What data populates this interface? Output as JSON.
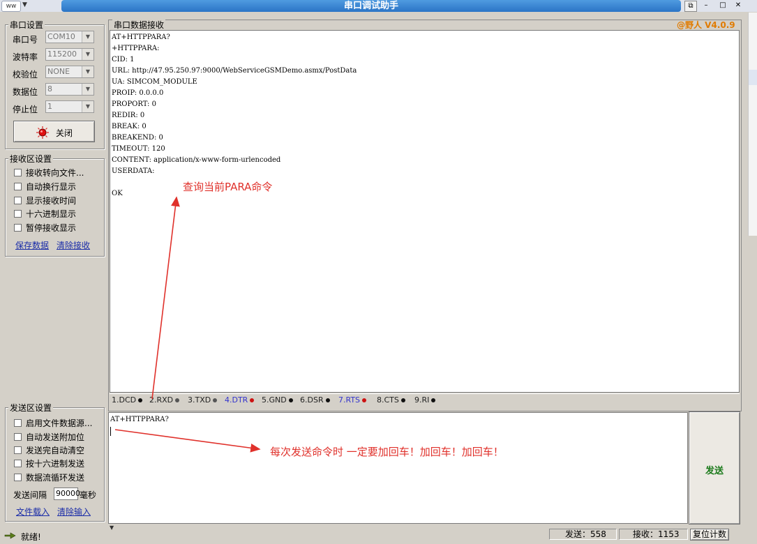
{
  "window": {
    "title": "串口调试助手",
    "sys_icon_text": "ww"
  },
  "serial_settings": {
    "group_title": "串口设置",
    "port_label": "串口号",
    "port_value": "COM10",
    "baud_label": "波特率",
    "baud_value": "115200",
    "parity_label": "校验位",
    "parity_value": "NONE",
    "databits_label": "数据位",
    "databits_value": "8",
    "stopbits_label": "停止位",
    "stopbits_value": "1",
    "close_button": "关闭"
  },
  "receive_settings": {
    "group_title": "接收区设置",
    "options": [
      "接收转向文件...",
      "自动换行显示",
      "显示接收时间",
      "十六进制显示",
      "暂停接收显示"
    ],
    "save_link": "保存数据",
    "clear_link": "清除接收"
  },
  "send_settings": {
    "group_title": "发送区设置",
    "options": [
      "启用文件数据源...",
      "自动发送附加位",
      "发送完自动清空",
      "按十六进制发送",
      "数据流循环发送"
    ],
    "interval_label": "发送间隔",
    "interval_value": "90000",
    "interval_unit": "毫秒",
    "load_link": "文件载入",
    "clear_link": "清除输入"
  },
  "receive_area": {
    "title": "串口数据接收",
    "version": "@野人 V4.0.9",
    "lines": [
      "AT+HTTPPARA?",
      "+HTTPPARA:",
      "CID: 1",
      "URL: http://47.95.250.97:9000/WebServiceGSMDemo.asmx/PostData",
      "UA: SIMCOM_MODULE",
      "PROIP: 0.0.0.0",
      "PROPORT: 0",
      "REDIR: 0",
      "BREAK: 0",
      "BREAKEND: 0",
      "TIMEOUT: 120",
      "CONTENT: application/x-www-form-urlencoded",
      "USERDATA:",
      "",
      "OK"
    ]
  },
  "pins": [
    {
      "label": "1.DCD",
      "color": "#111111"
    },
    {
      "label": "2.RXD",
      "color": "#555555"
    },
    {
      "label": "3.TXD",
      "color": "#555555"
    },
    {
      "label": "4.DTR",
      "color": "#cc1111"
    },
    {
      "label": "5.GND",
      "color": "#111111"
    },
    {
      "label": "6.DSR",
      "color": "#111111"
    },
    {
      "label": "7.RTS",
      "color": "#cc1111"
    },
    {
      "label": "8.CTS",
      "color": "#111111"
    },
    {
      "label": "9.RI",
      "color": "#111111"
    }
  ],
  "send_area": {
    "text": "AT+HTTPPARA?",
    "send_button": "发送"
  },
  "annotations": {
    "query": "查询当前PARA命令",
    "enter": "每次发送命令时 一定要加回车！加回车！加回车！"
  },
  "status": {
    "ready": "就绪!",
    "sent": "发送：558",
    "received": "接收：1153",
    "reset": "复位计数"
  },
  "colors": {
    "title_bar": "#2b74c6",
    "send_button_text": "#1a7a1a",
    "version_text": "#e07b00",
    "annotation": "#e0312b"
  }
}
